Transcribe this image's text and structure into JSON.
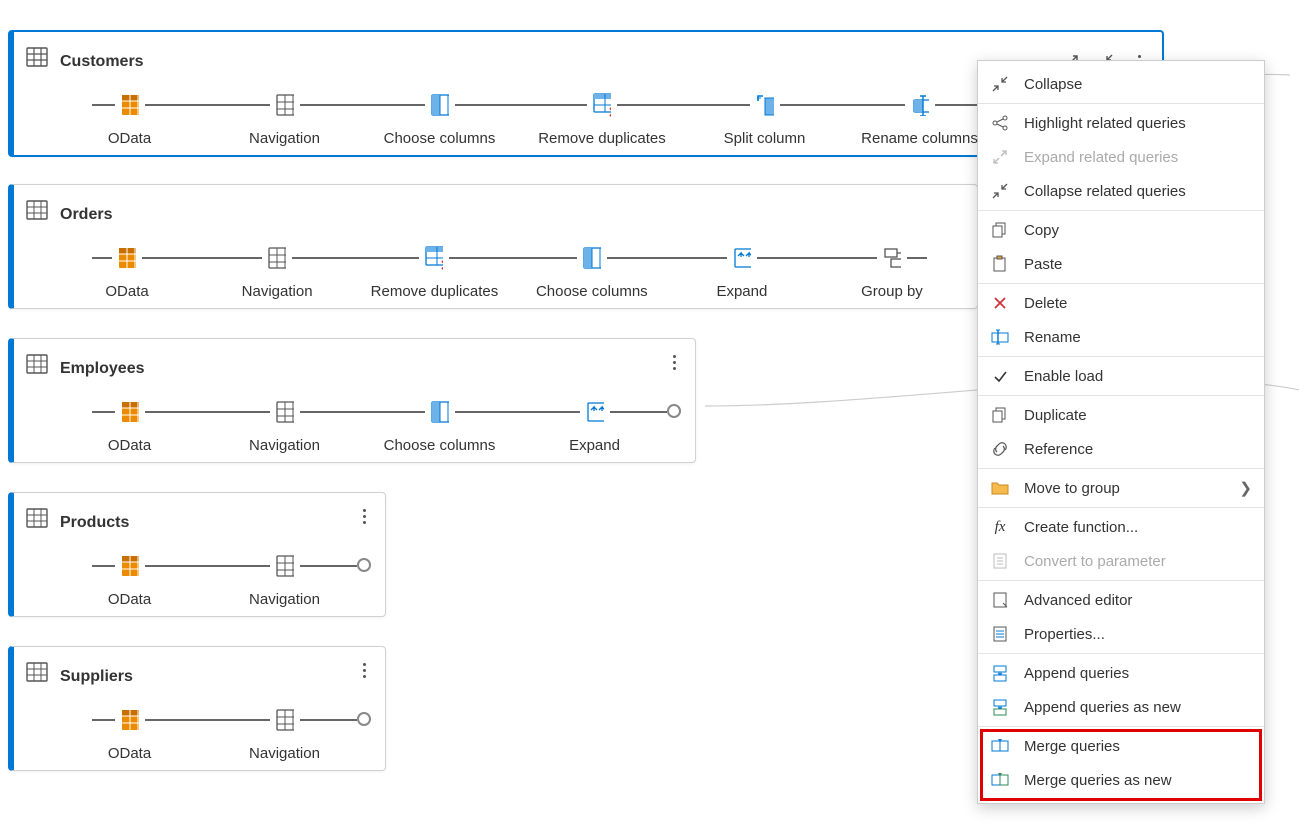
{
  "queries": {
    "customers": {
      "title": "Customers",
      "steps": [
        "OData",
        "Navigation",
        "Choose columns",
        "Remove duplicates",
        "Split column",
        "Rename columns"
      ]
    },
    "orders": {
      "title": "Orders",
      "steps": [
        "OData",
        "Navigation",
        "Remove duplicates",
        "Choose columns",
        "Expand",
        "Group by"
      ]
    },
    "employees": {
      "title": "Employees",
      "steps": [
        "OData",
        "Navigation",
        "Choose columns",
        "Expand"
      ]
    },
    "products": {
      "title": "Products",
      "steps": [
        "OData",
        "Navigation"
      ]
    },
    "suppliers": {
      "title": "Suppliers",
      "steps": [
        "OData",
        "Navigation"
      ]
    }
  },
  "menu": {
    "collapse": "Collapse",
    "highlight_related": "Highlight related queries",
    "expand_related": "Expand related queries",
    "collapse_related": "Collapse related queries",
    "copy": "Copy",
    "paste": "Paste",
    "delete": "Delete",
    "rename": "Rename",
    "enable_load": "Enable load",
    "duplicate": "Duplicate",
    "reference": "Reference",
    "move_to_group": "Move to group",
    "create_function": "Create function...",
    "convert_to_parameter": "Convert to parameter",
    "advanced_editor": "Advanced editor",
    "properties": "Properties...",
    "append_queries": "Append queries",
    "append_queries_new": "Append queries as new",
    "merge_queries": "Merge queries",
    "merge_queries_new": "Merge queries as new"
  },
  "icons": {
    "table": "table-icon",
    "odata": "odata-icon"
  },
  "colors": {
    "accent": "#0078d4",
    "odata": "#f5a623",
    "danger": "#e10000"
  }
}
